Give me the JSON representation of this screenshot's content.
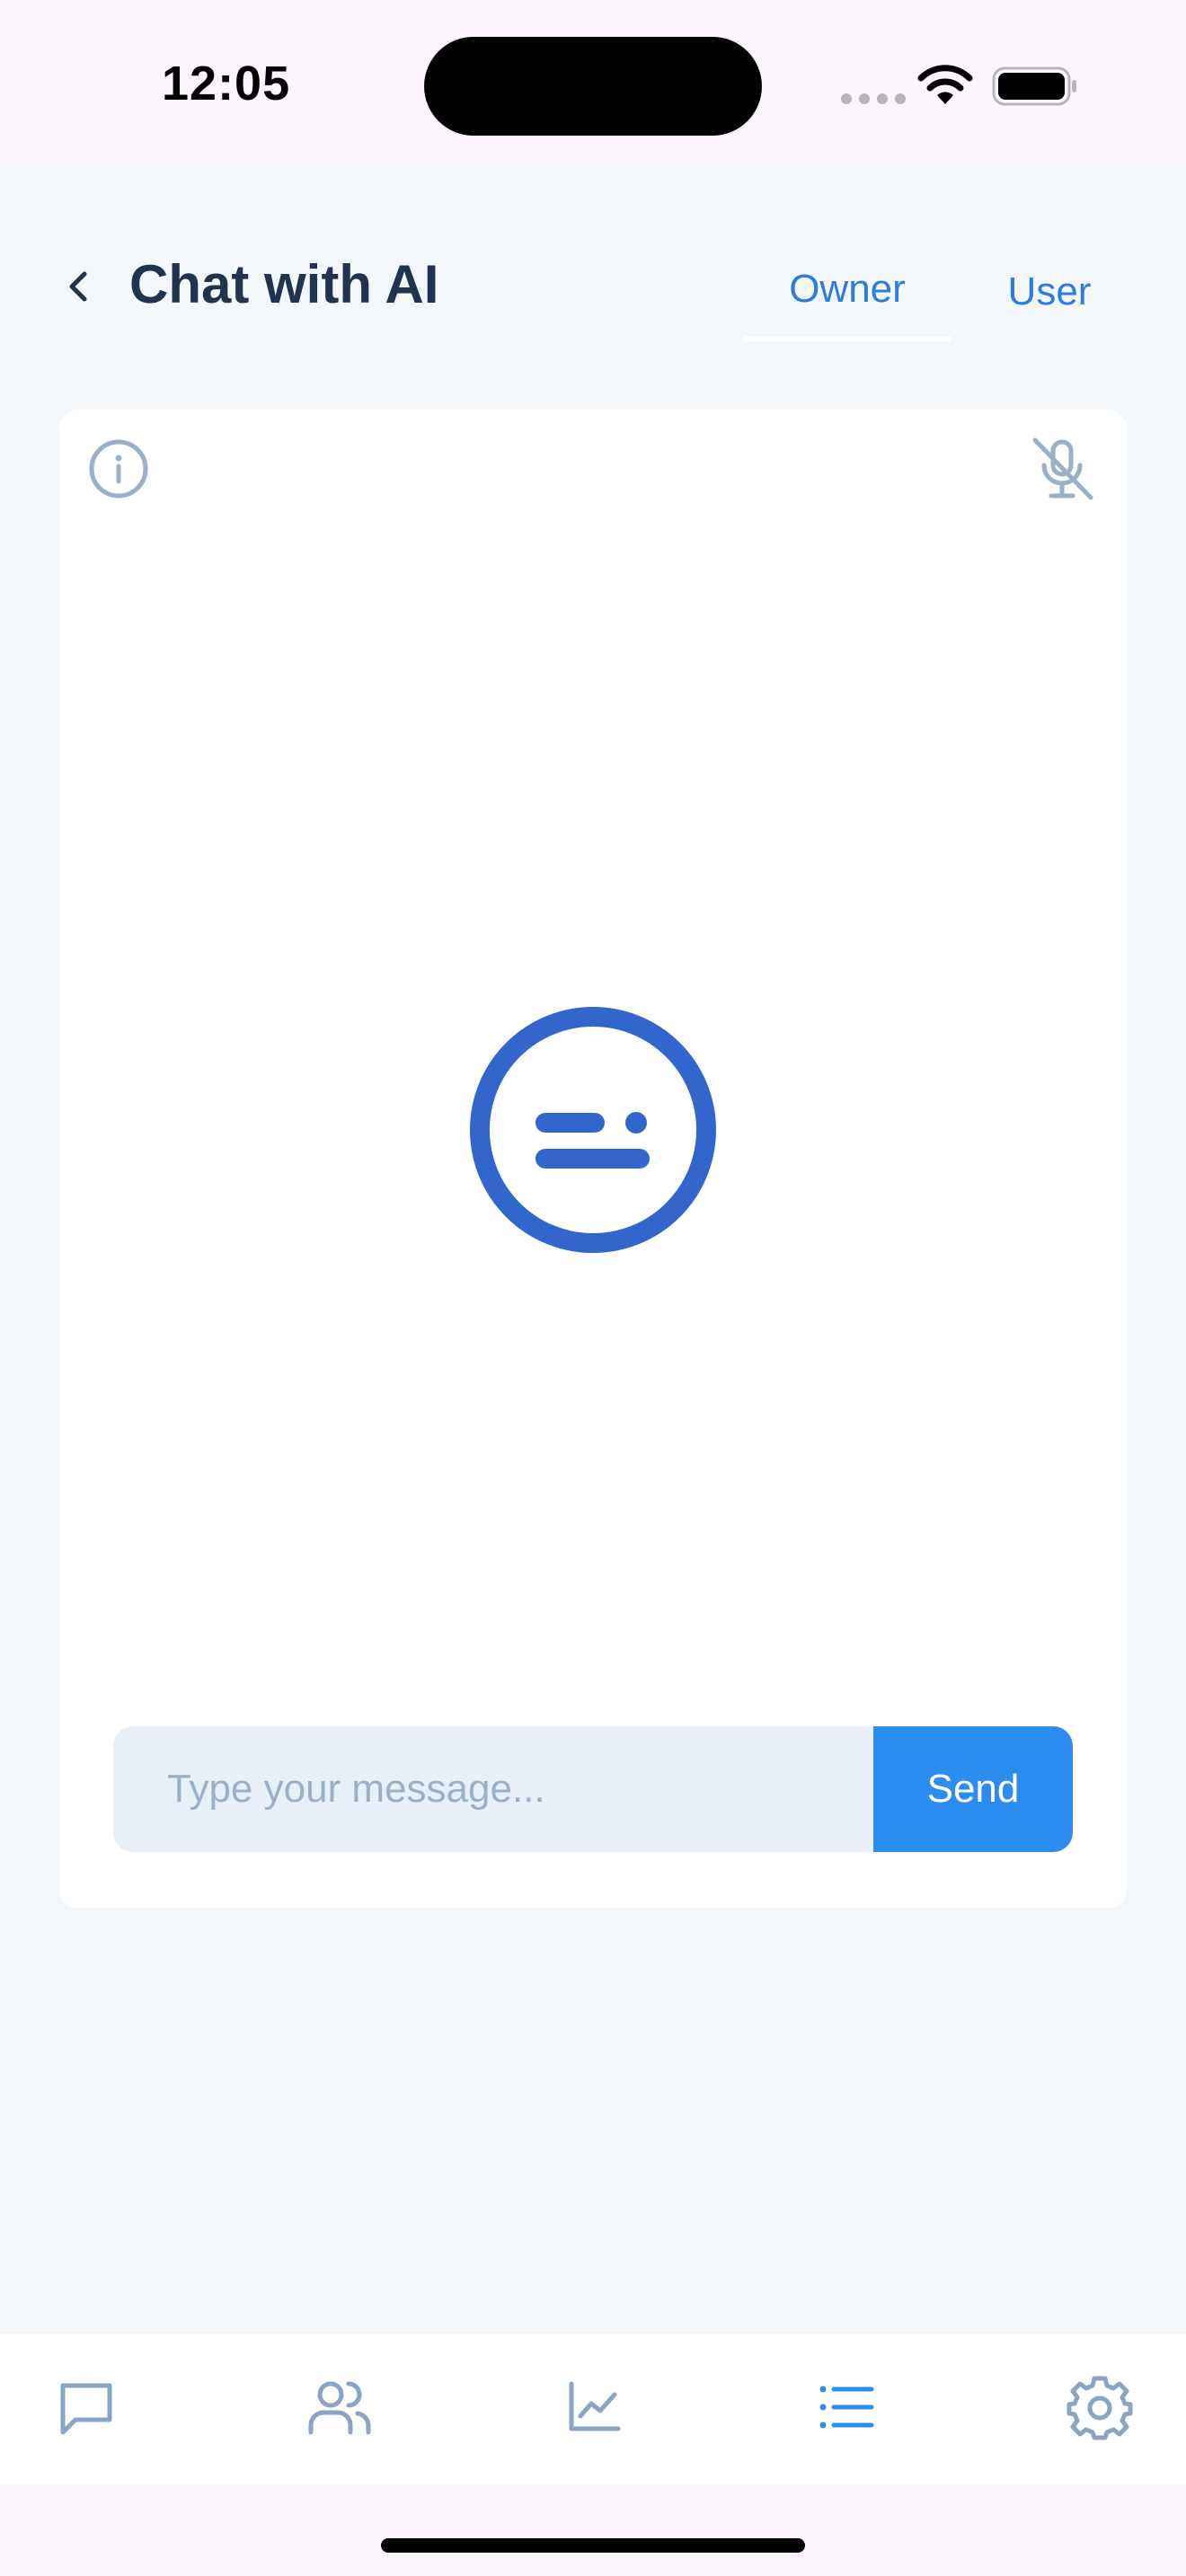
{
  "status_bar": {
    "time": "12:05",
    "icons": [
      "wifi-icon",
      "battery-icon"
    ]
  },
  "header": {
    "title": "Chat with AI",
    "back_icon": "chevron-left-icon",
    "tabs": [
      {
        "label": "Owner",
        "active": true
      },
      {
        "label": "User",
        "active": false
      }
    ]
  },
  "chat": {
    "info_icon": "info-icon",
    "mic_icon": "mic-off-icon",
    "bot_icon": "bot-face-icon",
    "input": {
      "value": "",
      "placeholder": "Type your message..."
    },
    "send_label": "Send"
  },
  "bottom_nav": {
    "items": [
      {
        "icon": "chat-bubble-icon",
        "active": false
      },
      {
        "icon": "users-icon",
        "active": false
      },
      {
        "icon": "chart-line-icon",
        "active": false
      },
      {
        "icon": "list-icon",
        "active": true
      },
      {
        "icon": "gear-icon",
        "active": false
      }
    ]
  },
  "colors": {
    "accent": "#2d8cf0",
    "tab_text": "#2d7de0",
    "title": "#22334f",
    "bot_icon": "#3366cc",
    "muted_icon": "#9bb0c8"
  }
}
